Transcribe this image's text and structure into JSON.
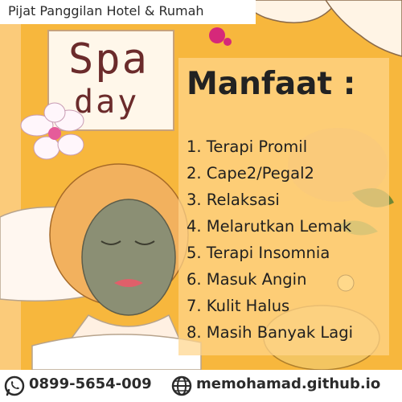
{
  "header": {
    "banner_text": "Pijat Panggilan Hotel & Rumah"
  },
  "logo": {
    "line1": "Spa",
    "line2": "day"
  },
  "benefits": {
    "title": "Manfaat :",
    "items": [
      "1. Terapi Promil",
      "2. Cape2/Pegal2",
      "3. Relaksasi",
      "4. Melarutkan Lemak",
      "5. Terapi Insomnia",
      "6. Masuk Angin",
      "7. Kulit Halus",
      "8. Masih Banyak Lagi"
    ]
  },
  "contact": {
    "phone": "0899-5654-009",
    "website": "memohamad.github.io",
    "phone_icon": "whatsapp-icon",
    "web_icon": "globe-icon"
  },
  "colors": {
    "background": "#f7b73d",
    "text": "#222222",
    "accent_dark": "#6b2b2b"
  }
}
